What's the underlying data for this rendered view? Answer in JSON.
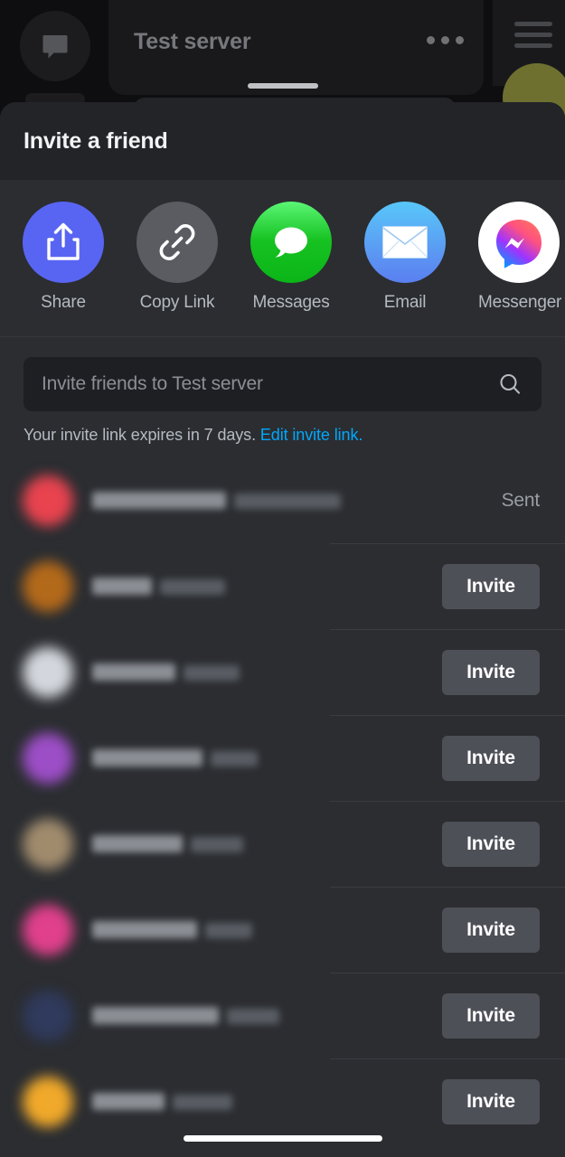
{
  "background": {
    "server_title": "Test server",
    "dm_icon": "chat-bubble-icon",
    "overflow_icon": "more-options-icon",
    "menu_icon": "hamburger-menu-icon"
  },
  "sheet": {
    "title": "Invite a friend"
  },
  "share_actions": [
    {
      "label": "Share",
      "icon": "share-upload-icon",
      "color": "#5865f2"
    },
    {
      "label": "Copy Link",
      "icon": "chain-link-icon",
      "color": "#5a5c62"
    },
    {
      "label": "Messages",
      "icon": "speech-bubble-icon",
      "color": "#16c221"
    },
    {
      "label": "Email",
      "icon": "envelope-icon",
      "color": "#5b93f2"
    },
    {
      "label": "Messenger",
      "icon": "messenger-bolt-icon",
      "color": "#ffffff"
    }
  ],
  "search": {
    "placeholder": "Invite friends to Test server",
    "value": "",
    "icon": "search-icon"
  },
  "invite_note": {
    "text": "Your invite link expires in 7 days.",
    "link_label": "Edit invite link.",
    "link_color": "#00a8fc"
  },
  "friend_list": {
    "invite_label": "Invite",
    "sent_label": "Sent",
    "rows": [
      {
        "avatar_color": "#e8434f",
        "name_width": 148,
        "handle_width": 118,
        "action": "sent"
      },
      {
        "avatar_color": "#b3691a",
        "name_width": 66,
        "handle_width": 72,
        "action": "invite"
      },
      {
        "avatar_color": "#d3d6dc",
        "name_width": 92,
        "handle_width": 62,
        "action": "invite"
      },
      {
        "avatar_color": "#9c4ec6",
        "name_width": 122,
        "handle_width": 52,
        "action": "invite"
      },
      {
        "avatar_color": "#a08b6d",
        "name_width": 100,
        "handle_width": 58,
        "action": "invite"
      },
      {
        "avatar_color": "#e0408c",
        "name_width": 116,
        "handle_width": 52,
        "action": "invite"
      },
      {
        "avatar_color": "#2f3a5c",
        "name_width": 140,
        "handle_width": 58,
        "action": "invite"
      },
      {
        "avatar_color": "#f0a92a",
        "name_width": 80,
        "handle_width": 66,
        "action": "invite"
      }
    ]
  }
}
